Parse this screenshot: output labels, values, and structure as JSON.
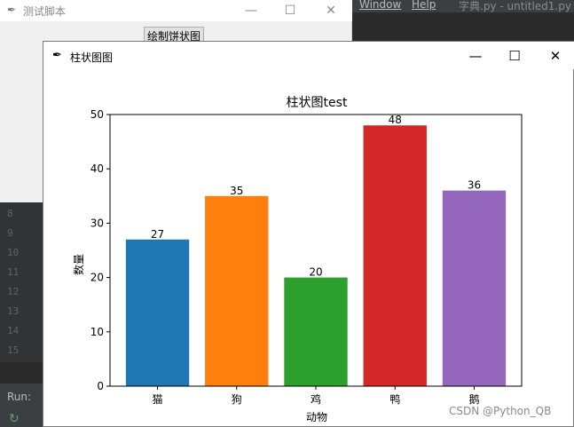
{
  "ide": {
    "menu": [
      "Window",
      "Help"
    ],
    "file_title": "字典.py - untitled1.py",
    "line_numbers": [
      "8",
      "9",
      "10",
      "11",
      "12",
      "13",
      "14",
      "15"
    ],
    "run_label": "Run:"
  },
  "bg_window": {
    "title": "测试脚本",
    "button_label": "绘制饼状图",
    "controls": [
      "—",
      "☐",
      "✕"
    ]
  },
  "chart_window": {
    "title": "柱状图图",
    "controls": [
      "—",
      "☐",
      "✕"
    ]
  },
  "chart_data": {
    "type": "bar",
    "title": "柱状图test",
    "xlabel": "动物",
    "ylabel": "数量",
    "categories": [
      "猫",
      "狗",
      "鸡",
      "鸭",
      "鹅"
    ],
    "values": [
      27,
      35,
      20,
      48,
      36
    ],
    "data_labels": [
      "27",
      "35",
      "20",
      "48",
      "36"
    ],
    "colors": [
      "#1f77b4",
      "#ff7f0e",
      "#2ca02c",
      "#d62728",
      "#9467bd"
    ],
    "ylim": [
      0,
      50
    ],
    "yticks": [
      0,
      10,
      20,
      30,
      40,
      50
    ],
    "grid": false
  },
  "watermark": "CSDN @Python_QB"
}
